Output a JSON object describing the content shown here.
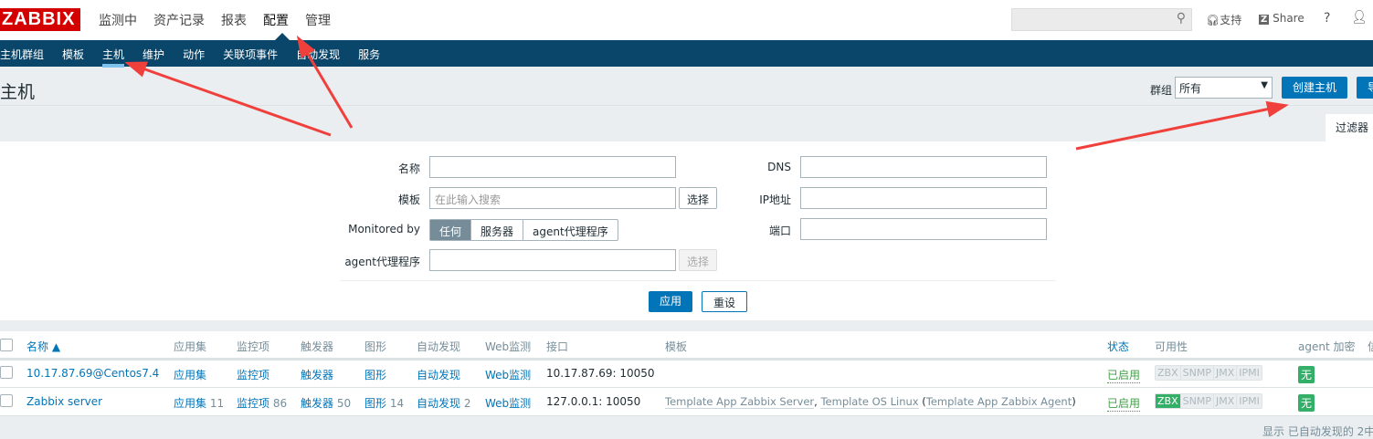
{
  "header": {
    "logo": "ZABBIX",
    "menu": [
      "监测中",
      "资产记录",
      "报表",
      "配置",
      "管理"
    ],
    "search_placeholder": "",
    "support": "支持",
    "share": "Share",
    "help": "?"
  },
  "nav": [
    "主机群组",
    "模板",
    "主机",
    "维护",
    "动作",
    "关联项事件",
    "自动发现",
    "服务"
  ],
  "page": {
    "title": "主机",
    "group_label": "群组",
    "group_value": "所有",
    "create_button": "创建主机",
    "import_button": "导",
    "filter_tab": "过滤器"
  },
  "filter": {
    "name_label": "名称",
    "template_label": "模板",
    "template_placeholder": "在此输入搜索",
    "select": "选择",
    "monitored_by_label": "Monitored by",
    "monitored_options": [
      "任何",
      "服务器",
      "agent代理程序"
    ],
    "proxy_label": "agent代理程序",
    "dns_label": "DNS",
    "ip_label": "IP地址",
    "port_label": "端口",
    "apply": "应用",
    "reset": "重设"
  },
  "table": {
    "headers": [
      "名称 ▲",
      "应用集",
      "监控项",
      "触发器",
      "图形",
      "自动发现",
      "Web监测",
      "接口",
      "模板",
      "状态",
      "可用性",
      "agent 加密",
      "信"
    ],
    "rows": [
      {
        "name": "10.17.87.69@Centos7.4",
        "apps": "应用集",
        "apps_n": "",
        "items": "监控项",
        "items_n": "",
        "triggers": "触发器",
        "triggers_n": "",
        "graphs": "图形",
        "graphs_n": "",
        "discovery": "自动发现",
        "discovery_n": "",
        "web": "Web监测",
        "interface": "10.17.87.69: 10050",
        "templates": [
          "",
          "",
          ""
        ],
        "status": "已启用",
        "zbx_on": false,
        "enc": "无"
      },
      {
        "name": "Zabbix server",
        "apps": "应用集",
        "apps_n": "11",
        "items": "监控项",
        "items_n": "86",
        "triggers": "触发器",
        "triggers_n": "50",
        "graphs": "图形",
        "graphs_n": "14",
        "discovery": "自动发现",
        "discovery_n": "2",
        "web": "Web监测",
        "interface": "127.0.0.1: 10050",
        "templates": [
          "Template App Zabbix Server",
          "Template OS Linux",
          "Template App Zabbix Agent"
        ],
        "status": "已启用",
        "zbx_on": true,
        "enc": "无"
      }
    ],
    "avail": [
      "ZBX",
      "SNMP",
      "JMX",
      "IPMI"
    ],
    "footer": "显示 已自动发现的 2中"
  },
  "colors": {
    "accent": "#0275b8",
    "nav": "#0a466a",
    "green": "#34af67",
    "logo": "#d40000",
    "arrow": "#f0403c"
  }
}
